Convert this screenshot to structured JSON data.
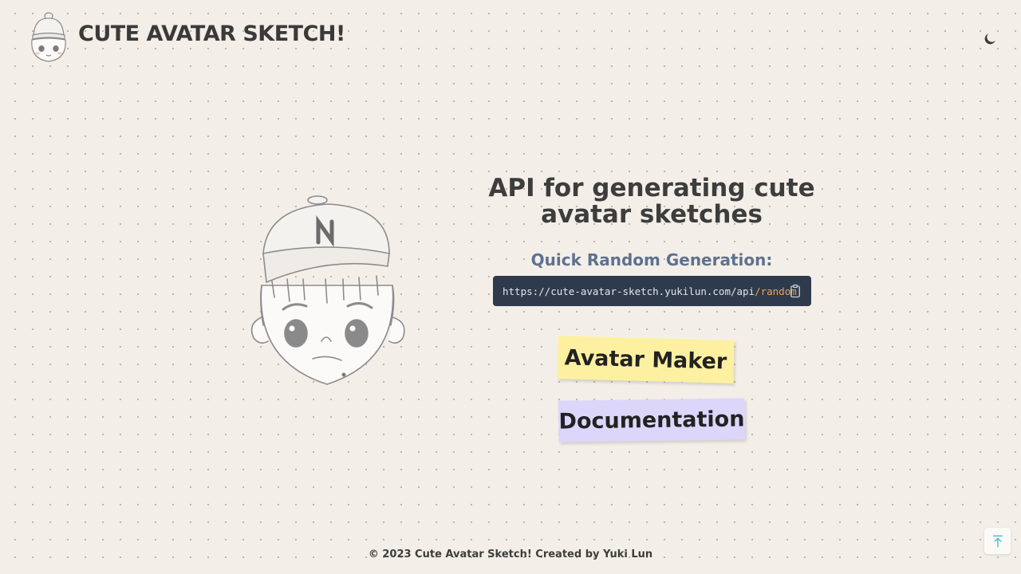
{
  "header": {
    "title": "CUTE AVATAR SKETCH!",
    "logo_icon": "avatar-beanie-icon",
    "theme_toggle_icon": "moon-icon"
  },
  "hero": {
    "image_icon": "avatar-cap-sketch-icon",
    "headline": "API for generating cute avatar sketches",
    "subheading": "Quick Random Generation:",
    "api_url_base": "https://cute-avatar-sketch.yukilun.com/api",
    "api_url_suffix": "/random",
    "copy_icon": "clipboard-icon"
  },
  "buttons": {
    "avatar_maker": "Avatar Maker",
    "documentation": "Documentation"
  },
  "footer": {
    "text": "© 2023 Cute Avatar Sketch! Created by Yuki Lun"
  },
  "back_to_top_icon": "arrow-up-to-line-icon",
  "colors": {
    "background": "#f3efe8",
    "code_bg": "#2f3a4c",
    "code_suffix": "#f0a24a",
    "subheading": "#5f7190",
    "maker_button": "#fdf1a1",
    "docs_button": "#ddd6fb",
    "accent_teal": "#4fc3c7"
  }
}
